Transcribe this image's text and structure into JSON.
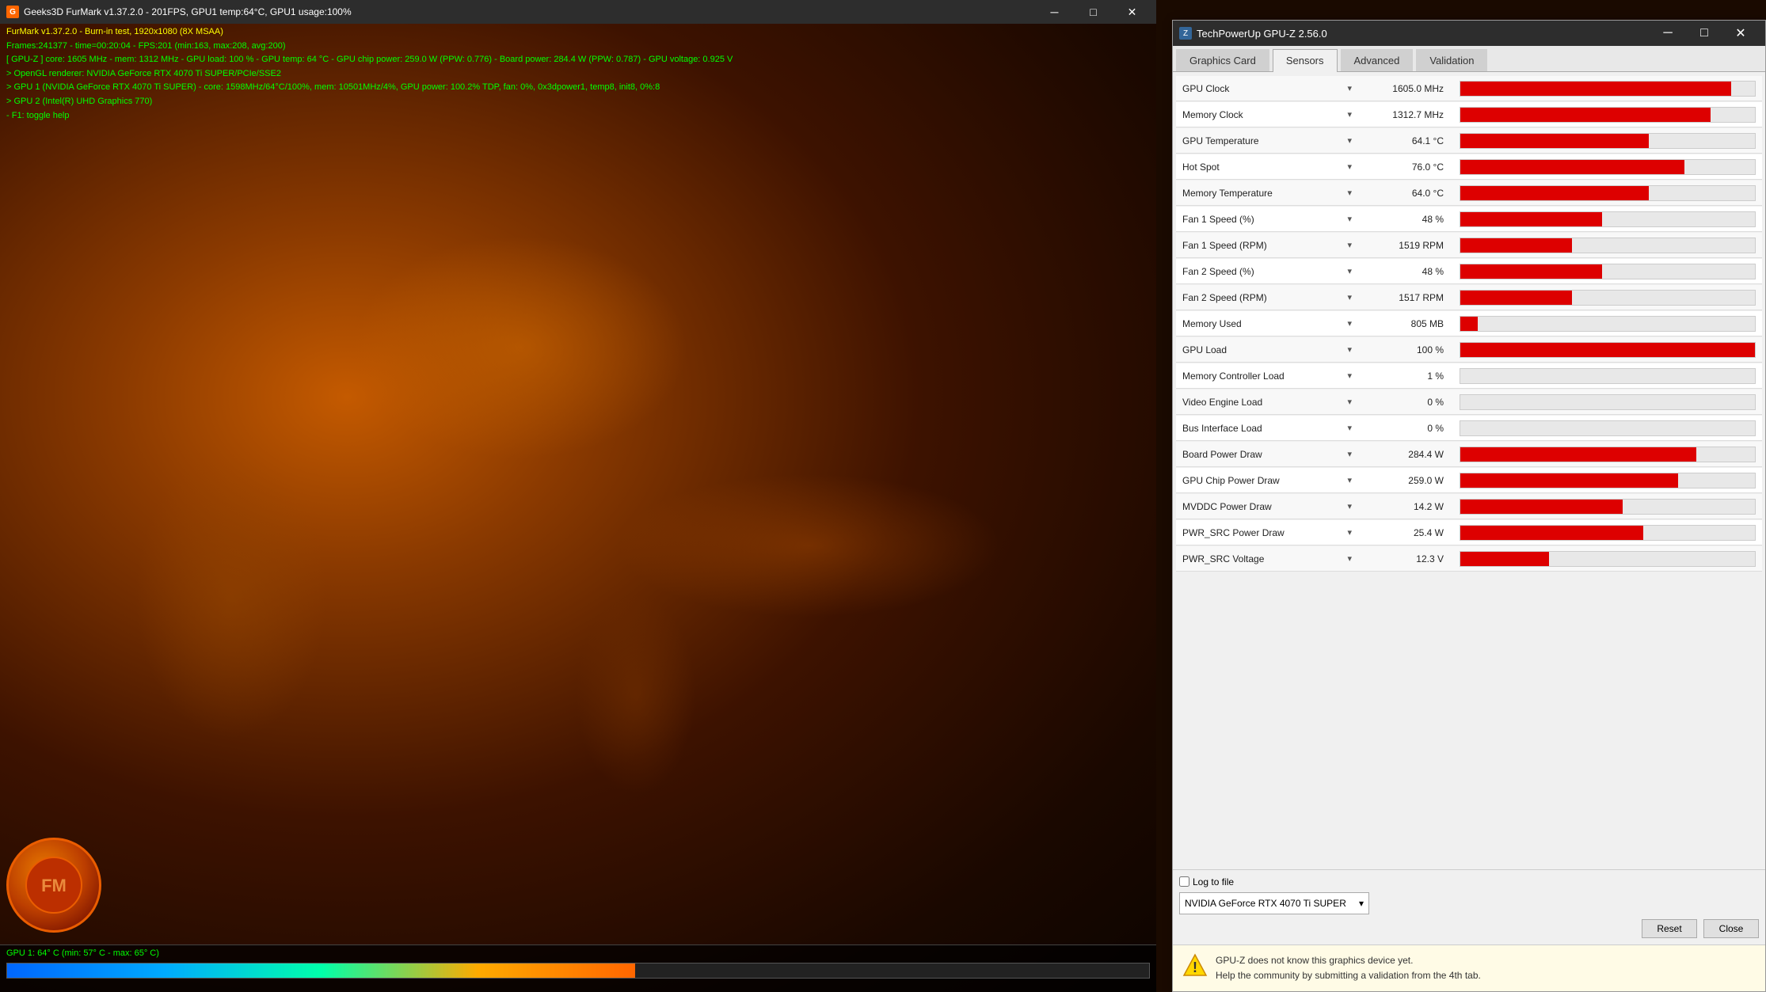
{
  "furmark": {
    "title": "Geeks3D FurMark v1.37.2.0 - 201FPS, GPU1 temp:64°C, GPU1 usage:100%",
    "info_lines": [
      {
        "text": "FurMark v1.37.2.0 - Burn-in test, 1920x1080 (8X MSAA)",
        "color": "yellow"
      },
      {
        "text": "Frames:241377 - time=00:20:04 - FPS:201 (min:163, max:208, avg:200)",
        "color": "green"
      },
      {
        "text": "[ GPU-Z ] core: 1605 MHz - mem: 1312 MHz - GPU load: 100 % - GPU temp: 64 °C - GPU chip power: 259.0 W (PPW: 0.776) - Board power: 284.4 W (PPW: 0.787) - GPU voltage: 0.925 V",
        "color": "green"
      },
      {
        "text": "> OpenGL renderer: NVIDIA GeForce RTX 4070 Ti SUPER/PCIe/SSE2",
        "color": "green"
      },
      {
        "text": "> GPU 1 (NVIDIA GeForce RTX 4070 Ti SUPER) - core: 1598MHz/64°C/100%, mem: 10501MHz/4%, GPU power: 100.2% TDP, fan: 0%, 0x3dpower1, temp8, init8, 0%:8",
        "color": "green"
      },
      {
        "text": "> GPU 2 (Intel(R) UHD Graphics 770)",
        "color": "green"
      },
      {
        "text": "- F1: toggle help",
        "color": "green"
      }
    ],
    "temp_label": "GPU 1: 64° C (min: 57° C - max: 65° C)",
    "win_controls": [
      "─",
      "□",
      "✕"
    ]
  },
  "gpuz": {
    "title": "TechPowerUp GPU-Z 2.56.0",
    "tabs": [
      {
        "label": "Graphics Card",
        "active": false
      },
      {
        "label": "Sensors",
        "active": true
      },
      {
        "label": "Advanced",
        "active": false
      },
      {
        "label": "Validation",
        "active": false
      }
    ],
    "win_controls": [
      "─",
      "□",
      "✕"
    ],
    "sensors": [
      {
        "name": "GPU Clock",
        "value": "1605.0 MHz",
        "bar_pct": 92,
        "has_bar": true
      },
      {
        "name": "Memory Clock",
        "value": "1312.7 MHz",
        "bar_pct": 85,
        "has_bar": true
      },
      {
        "name": "GPU Temperature",
        "value": "64.1 °C",
        "bar_pct": 64,
        "has_bar": true
      },
      {
        "name": "Hot Spot",
        "value": "76.0 °C",
        "bar_pct": 76,
        "has_bar": true
      },
      {
        "name": "Memory Temperature",
        "value": "64.0 °C",
        "bar_pct": 64,
        "has_bar": true
      },
      {
        "name": "Fan 1 Speed (%)",
        "value": "48 %",
        "bar_pct": 48,
        "has_bar": true
      },
      {
        "name": "Fan 1 Speed (RPM)",
        "value": "1519 RPM",
        "bar_pct": 38,
        "has_bar": true
      },
      {
        "name": "Fan 2 Speed (%)",
        "value": "48 %",
        "bar_pct": 48,
        "has_bar": true
      },
      {
        "name": "Fan 2 Speed (RPM)",
        "value": "1517 RPM",
        "bar_pct": 38,
        "has_bar": true
      },
      {
        "name": "Memory Used",
        "value": "805 MB",
        "bar_pct": 6,
        "has_bar": true
      },
      {
        "name": "GPU Load",
        "value": "100 %",
        "bar_pct": 100,
        "has_bar": true
      },
      {
        "name": "Memory Controller Load",
        "value": "1 %",
        "bar_pct": 1,
        "has_bar": false
      },
      {
        "name": "Video Engine Load",
        "value": "0 %",
        "bar_pct": 0,
        "has_bar": false
      },
      {
        "name": "Bus Interface Load",
        "value": "0 %",
        "bar_pct": 0,
        "has_bar": false
      },
      {
        "name": "Board Power Draw",
        "value": "284.4 W",
        "bar_pct": 80,
        "has_bar": true
      },
      {
        "name": "GPU Chip Power Draw",
        "value": "259.0 W",
        "bar_pct": 74,
        "has_bar": true
      },
      {
        "name": "MVDDC Power Draw",
        "value": "14.2 W",
        "bar_pct": 55,
        "has_bar": true
      },
      {
        "name": "PWR_SRC Power Draw",
        "value": "25.4 W",
        "bar_pct": 62,
        "has_bar": true
      },
      {
        "name": "PWR_SRC Voltage",
        "value": "12.3 V",
        "bar_pct": 30,
        "has_bar": true
      }
    ],
    "gpu_selector": {
      "value": "NVIDIA GeForce RTX 4070 Ti SUPER",
      "label": "NVIDIA GeForce RTX 4070 Ti SUPER"
    },
    "buttons": {
      "reset": "Reset",
      "close": "Close"
    },
    "log_to_file": "Log to file",
    "warning": {
      "text1": "GPU-Z does not know this graphics device yet.",
      "text2": "Help the community by submitting a validation from the 4th tab."
    }
  }
}
